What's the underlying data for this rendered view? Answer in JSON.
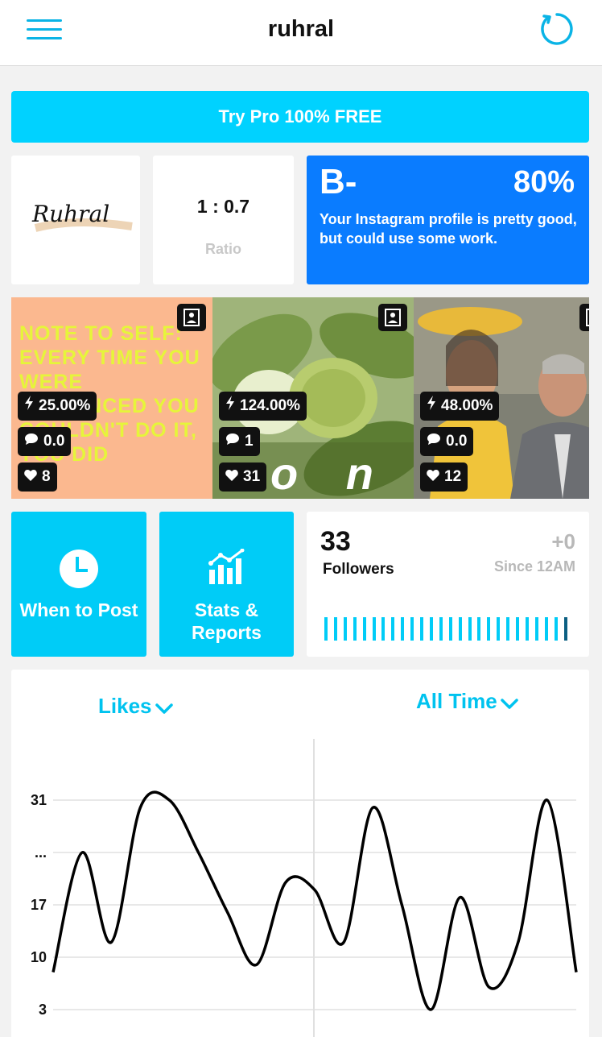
{
  "header": {
    "title": "ruhral"
  },
  "promo": {
    "label": "Try Pro 100% FREE"
  },
  "profile": {
    "logo_text": "Ruhral",
    "ratio_value": "1 : 0.7",
    "ratio_label": "Ratio",
    "grade": "B-",
    "grade_percent": "80%",
    "grade_message": "Your Instagram profile is pretty good, but could use some work."
  },
  "posts": [
    {
      "engagement": "25.00%",
      "comments": "0.0",
      "likes": "8",
      "overlay_text": "NOTE TO SELF: EVERY TIME YOU WERE CONVINCED YOU COULDN'T DO IT, YOU DID"
    },
    {
      "engagement": "124.00%",
      "comments": "1",
      "likes": "31",
      "overlay_text": "o n"
    },
    {
      "engagement": "48.00%",
      "comments": "0.0",
      "likes": "12",
      "overlay_text": ""
    }
  ],
  "actions": {
    "when_to_post": "When to Post",
    "stats_reports": "Stats & Reports"
  },
  "followers": {
    "count": "33",
    "label": "Followers",
    "delta": "+0",
    "since": "Since 12AM"
  },
  "chart_controls": {
    "metric": "Likes",
    "range": "All Time"
  },
  "chart_data": {
    "type": "line",
    "title": "",
    "xlabel": "",
    "ylabel": "",
    "y_ticks": [
      "31",
      "...",
      "17",
      "10",
      "3"
    ],
    "series": [
      {
        "values": [
          8,
          24,
          12,
          30,
          31,
          24,
          16,
          9,
          20,
          19,
          12,
          30,
          17,
          3,
          18,
          6,
          12,
          31,
          8
        ]
      }
    ],
    "grid": true,
    "colors": {
      "line": "#000000",
      "grid": "#e0e0e0"
    }
  },
  "colors": {
    "accent": "#00ccf7",
    "grade_bg": "#0a7cff",
    "brand_blue": "#0ab4e6"
  }
}
